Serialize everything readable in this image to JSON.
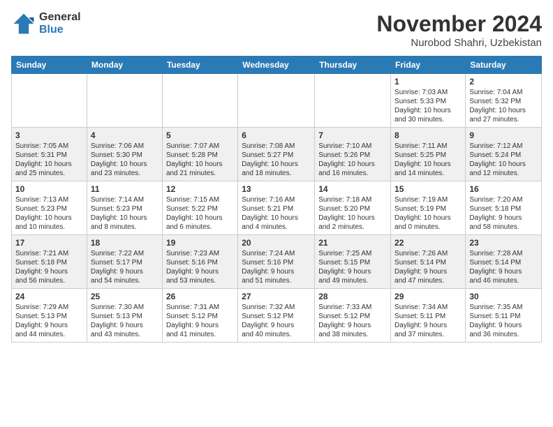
{
  "logo": {
    "general": "General",
    "blue": "Blue"
  },
  "title": "November 2024",
  "location": "Nurobod Shahri, Uzbekistan",
  "days_of_week": [
    "Sunday",
    "Monday",
    "Tuesday",
    "Wednesday",
    "Thursday",
    "Friday",
    "Saturday"
  ],
  "weeks": [
    [
      {
        "day": "",
        "info": ""
      },
      {
        "day": "",
        "info": ""
      },
      {
        "day": "",
        "info": ""
      },
      {
        "day": "",
        "info": ""
      },
      {
        "day": "",
        "info": ""
      },
      {
        "day": "1",
        "info": "Sunrise: 7:03 AM\nSunset: 5:33 PM\nDaylight: 10 hours\nand 30 minutes."
      },
      {
        "day": "2",
        "info": "Sunrise: 7:04 AM\nSunset: 5:32 PM\nDaylight: 10 hours\nand 27 minutes."
      }
    ],
    [
      {
        "day": "3",
        "info": "Sunrise: 7:05 AM\nSunset: 5:31 PM\nDaylight: 10 hours\nand 25 minutes."
      },
      {
        "day": "4",
        "info": "Sunrise: 7:06 AM\nSunset: 5:30 PM\nDaylight: 10 hours\nand 23 minutes."
      },
      {
        "day": "5",
        "info": "Sunrise: 7:07 AM\nSunset: 5:28 PM\nDaylight: 10 hours\nand 21 minutes."
      },
      {
        "day": "6",
        "info": "Sunrise: 7:08 AM\nSunset: 5:27 PM\nDaylight: 10 hours\nand 18 minutes."
      },
      {
        "day": "7",
        "info": "Sunrise: 7:10 AM\nSunset: 5:26 PM\nDaylight: 10 hours\nand 16 minutes."
      },
      {
        "day": "8",
        "info": "Sunrise: 7:11 AM\nSunset: 5:25 PM\nDaylight: 10 hours\nand 14 minutes."
      },
      {
        "day": "9",
        "info": "Sunrise: 7:12 AM\nSunset: 5:24 PM\nDaylight: 10 hours\nand 12 minutes."
      }
    ],
    [
      {
        "day": "10",
        "info": "Sunrise: 7:13 AM\nSunset: 5:23 PM\nDaylight: 10 hours\nand 10 minutes."
      },
      {
        "day": "11",
        "info": "Sunrise: 7:14 AM\nSunset: 5:23 PM\nDaylight: 10 hours\nand 8 minutes."
      },
      {
        "day": "12",
        "info": "Sunrise: 7:15 AM\nSunset: 5:22 PM\nDaylight: 10 hours\nand 6 minutes."
      },
      {
        "day": "13",
        "info": "Sunrise: 7:16 AM\nSunset: 5:21 PM\nDaylight: 10 hours\nand 4 minutes."
      },
      {
        "day": "14",
        "info": "Sunrise: 7:18 AM\nSunset: 5:20 PM\nDaylight: 10 hours\nand 2 minutes."
      },
      {
        "day": "15",
        "info": "Sunrise: 7:19 AM\nSunset: 5:19 PM\nDaylight: 10 hours\nand 0 minutes."
      },
      {
        "day": "16",
        "info": "Sunrise: 7:20 AM\nSunset: 5:18 PM\nDaylight: 9 hours\nand 58 minutes."
      }
    ],
    [
      {
        "day": "17",
        "info": "Sunrise: 7:21 AM\nSunset: 5:18 PM\nDaylight: 9 hours\nand 56 minutes."
      },
      {
        "day": "18",
        "info": "Sunrise: 7:22 AM\nSunset: 5:17 PM\nDaylight: 9 hours\nand 54 minutes."
      },
      {
        "day": "19",
        "info": "Sunrise: 7:23 AM\nSunset: 5:16 PM\nDaylight: 9 hours\nand 53 minutes."
      },
      {
        "day": "20",
        "info": "Sunrise: 7:24 AM\nSunset: 5:16 PM\nDaylight: 9 hours\nand 51 minutes."
      },
      {
        "day": "21",
        "info": "Sunrise: 7:25 AM\nSunset: 5:15 PM\nDaylight: 9 hours\nand 49 minutes."
      },
      {
        "day": "22",
        "info": "Sunrise: 7:26 AM\nSunset: 5:14 PM\nDaylight: 9 hours\nand 47 minutes."
      },
      {
        "day": "23",
        "info": "Sunrise: 7:28 AM\nSunset: 5:14 PM\nDaylight: 9 hours\nand 46 minutes."
      }
    ],
    [
      {
        "day": "24",
        "info": "Sunrise: 7:29 AM\nSunset: 5:13 PM\nDaylight: 9 hours\nand 44 minutes."
      },
      {
        "day": "25",
        "info": "Sunrise: 7:30 AM\nSunset: 5:13 PM\nDaylight: 9 hours\nand 43 minutes."
      },
      {
        "day": "26",
        "info": "Sunrise: 7:31 AM\nSunset: 5:12 PM\nDaylight: 9 hours\nand 41 minutes."
      },
      {
        "day": "27",
        "info": "Sunrise: 7:32 AM\nSunset: 5:12 PM\nDaylight: 9 hours\nand 40 minutes."
      },
      {
        "day": "28",
        "info": "Sunrise: 7:33 AM\nSunset: 5:12 PM\nDaylight: 9 hours\nand 38 minutes."
      },
      {
        "day": "29",
        "info": "Sunrise: 7:34 AM\nSunset: 5:11 PM\nDaylight: 9 hours\nand 37 minutes."
      },
      {
        "day": "30",
        "info": "Sunrise: 7:35 AM\nSunset: 5:11 PM\nDaylight: 9 hours\nand 36 minutes."
      }
    ]
  ]
}
